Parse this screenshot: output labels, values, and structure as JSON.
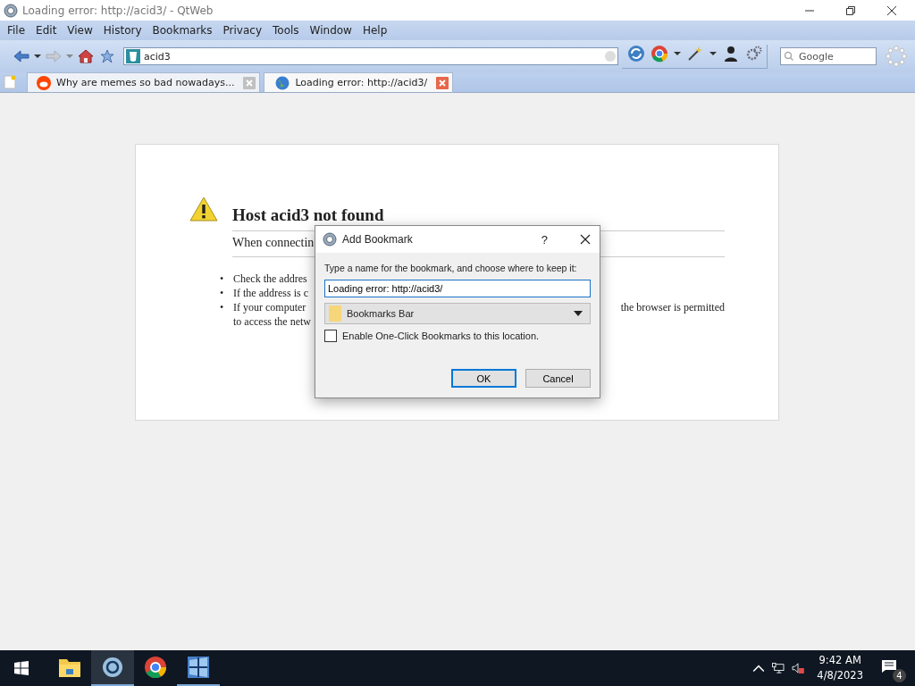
{
  "window": {
    "title": "Loading error: http://acid3/ - QtWeb"
  },
  "menu": [
    "File",
    "Edit",
    "View",
    "History",
    "Bookmarks",
    "Privacy",
    "Tools",
    "Window",
    "Help"
  ],
  "address_bar": {
    "value": "acid3"
  },
  "search": {
    "placeholder": "Google"
  },
  "tabs": [
    {
      "title": "Why are memes so bad nowadays...",
      "kind": "reddit",
      "selected": false
    },
    {
      "title": "Loading error: http://acid3/",
      "kind": "globe",
      "selected": true
    }
  ],
  "error_page": {
    "title": "Host acid3 not found",
    "subtitle": "When connectin",
    "bullets": [
      {
        "marker": "•",
        "text": "Check the addres"
      },
      {
        "marker": "•",
        "text": "If the address is c"
      },
      {
        "marker": "•",
        "text": "If your computer",
        "continued": "the browser is permitted",
        "second_line": "to access the netw"
      }
    ]
  },
  "dialog": {
    "title": "Add Bookmark",
    "help": "?",
    "prompt": "Type a name for the bookmark, and choose where to keep it:",
    "name_value": "Loading error: http://acid3/",
    "folder": "Bookmarks Bar",
    "checkbox": {
      "label": "Enable One-Click Bookmarks to this location.",
      "checked": false
    },
    "buttons": [
      {
        "label": "OK",
        "default": true
      },
      {
        "label": "Cancel",
        "default": false
      }
    ]
  },
  "taskbar": {
    "apps": [
      {
        "kind": "files",
        "running": false,
        "selected": false
      },
      {
        "kind": "qt",
        "running": true,
        "selected": true
      },
      {
        "kind": "chrome",
        "running": false,
        "selected": false
      },
      {
        "kind": "xp",
        "running": true,
        "selected": false
      }
    ],
    "time": "9:42 AM",
    "date": "4/8/2023",
    "notifications": "4"
  }
}
